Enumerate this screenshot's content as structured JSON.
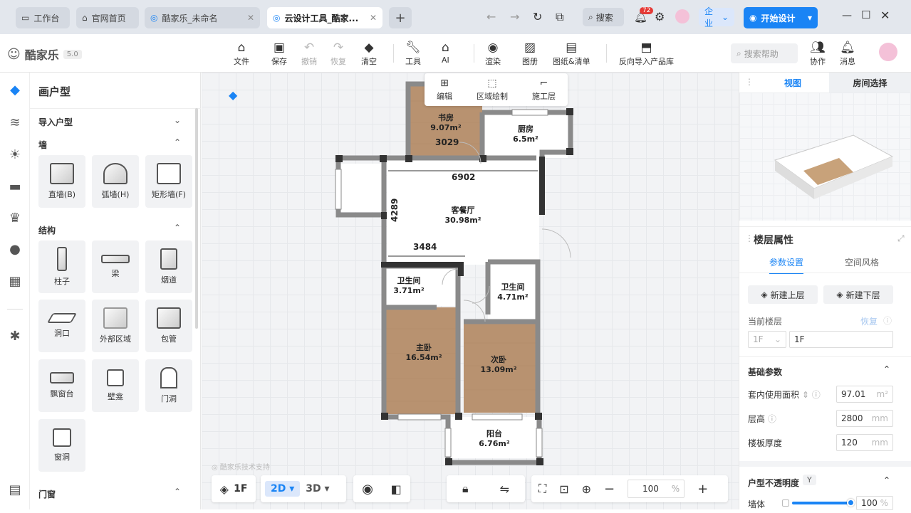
{
  "tabs": [
    {
      "label": "工作台",
      "icon": "desktop-icon"
    },
    {
      "label": "官网首页",
      "icon": "home-icon"
    },
    {
      "label": "酷家乐_未命名",
      "icon": "app-icon"
    },
    {
      "label": "云设计工具_酷家...",
      "icon": "app-icon"
    }
  ],
  "topbar": {
    "search": "搜索",
    "badge": "72",
    "enterprise": "企业",
    "start": "开始设计"
  },
  "brand": {
    "name": "酷家乐",
    "version": "5.0"
  },
  "toolbar": {
    "file": "文件",
    "save": "保存",
    "undo": "撤销",
    "redo": "恢复",
    "clear": "清空",
    "tools": "工具",
    "ai": "AI",
    "render": "渲染",
    "image": "图册",
    "drawings": "图纸&清单",
    "reverse_import": "反向导入产品库",
    "help_search": "搜索帮助",
    "collab": "协作",
    "message": "消息"
  },
  "left_panel": {
    "title": "画户型",
    "import": "导入户型",
    "wall_section": "墙",
    "walls": [
      "直墙(B)",
      "弧墙(H)",
      "矩形墙(F)"
    ],
    "struct_section": "结构",
    "structures": [
      "柱子",
      "梁",
      "烟道",
      "洞口",
      "外部区域",
      "包管",
      "飘窗台",
      "壁龛",
      "门洞",
      "窗洞"
    ],
    "door_section": "门窗"
  },
  "float_tool": {
    "edit": "编辑",
    "region": "区域绘制",
    "construct": "施工层"
  },
  "floorplan": {
    "rooms": [
      {
        "name": "书房",
        "area": "9.07m²"
      },
      {
        "name": "厨房",
        "area": "6.5m²"
      },
      {
        "name": "客餐厅",
        "area": "30.98m²"
      },
      {
        "name": "卫生间",
        "area": "3.71m²"
      },
      {
        "name": "卫生间",
        "area": "4.71m²"
      },
      {
        "name": "主卧",
        "area": "16.54m²"
      },
      {
        "name": "次卧",
        "area": "13.09m²"
      },
      {
        "name": "阳台",
        "area": "6.76m²"
      }
    ],
    "dims": [
      "3029",
      "6902",
      "4289",
      "3484"
    ],
    "watermark": "酷家乐技术支持"
  },
  "bottombar": {
    "floor": "1F",
    "mode2d": "2D",
    "mode3d": "3D",
    "zoom": "100",
    "zoom_unit": "%"
  },
  "right_panel": {
    "view_tab": "视图",
    "room_tab": "房间选择",
    "title": "楼层属性",
    "tab_params": "参数设置",
    "tab_style": "空间风格",
    "new_up": "新建上层",
    "new_down": "新建下层",
    "current_floor": "当前楼层",
    "restore": "恢复",
    "floor_select": "1F",
    "floor_name": "1F",
    "basic": "基础参数",
    "area_label": "套内使用面积",
    "area_value": "97.01",
    "area_unit": "m²",
    "height_label": "层高",
    "height_value": "2800",
    "height_unit": "mm",
    "slab_label": "楼板厚度",
    "slab_value": "120",
    "slab_unit": "mm",
    "opacity_title": "户型不透明度",
    "opacity_key": "Y",
    "wall_label": "墙体",
    "wall_value": "100",
    "wall_unit": "%"
  },
  "colors": {
    "accent": "#1a84f5",
    "wall": "#3a3a3a",
    "floor_wood": "#b89270"
  }
}
